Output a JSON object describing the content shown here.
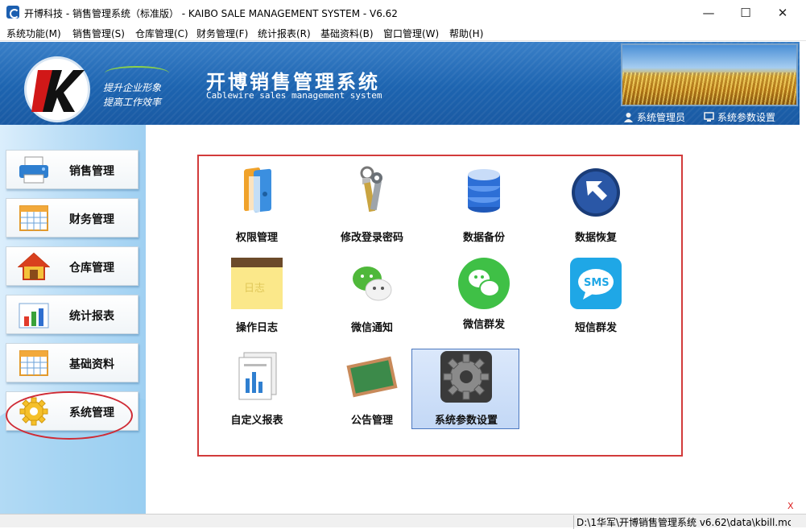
{
  "window": {
    "title": "开博科技 - 销售管理系统（标准版）      - KAIBO SALE MANAGEMENT SYSTEM - V6.62",
    "minimize": "—",
    "maximize": "☐",
    "close": "✕"
  },
  "menu": [
    "系统功能(M)",
    "销售管理(S)",
    "仓库管理(C)",
    "财务管理(F)",
    "统计报表(R)",
    "基础资料(B)",
    "窗口管理(W)",
    "帮助(H)"
  ],
  "header": {
    "slogan_line1": "提升企业形象",
    "slogan_line2": "提高工作效率",
    "system_title": "开博销售管理系统",
    "system_subtitle": "Cablewire sales management system",
    "links": {
      "admin": "系统管理员",
      "settings": "系统参数设置"
    }
  },
  "sidebar": {
    "items": [
      {
        "label": "销售管理",
        "icon": "printer-icon"
      },
      {
        "label": "财务管理",
        "icon": "calendar-icon"
      },
      {
        "label": "仓库管理",
        "icon": "house-icon"
      },
      {
        "label": "统计报表",
        "icon": "bar-chart-icon"
      },
      {
        "label": "基础资料",
        "icon": "table-icon"
      },
      {
        "label": "系统管理",
        "icon": "gear-icon"
      }
    ],
    "active": "系统管理"
  },
  "tiles": [
    {
      "label": "权限管理",
      "icon": "folders-icon"
    },
    {
      "label": "修改登录密码",
      "icon": "keys-icon"
    },
    {
      "label": "数据备份",
      "icon": "database-icon"
    },
    {
      "label": "数据恢复",
      "icon": "restore-arrow-icon"
    },
    {
      "label": "操作日志",
      "icon": "notepad-icon"
    },
    {
      "label": "微信通知",
      "icon": "wechat-icon"
    },
    {
      "label": "微信群发",
      "icon": "wechat-group-icon"
    },
    {
      "label": "短信群发",
      "icon": "sms-icon"
    },
    {
      "label": "自定义报表",
      "icon": "report-icon"
    },
    {
      "label": "公告管理",
      "icon": "board-icon"
    },
    {
      "label": "系统参数设置",
      "icon": "settings-gear-icon"
    }
  ],
  "selected_tile": "系统参数设置",
  "status": {
    "path": "D:\\1华军\\开博销售管理系统 v6.62\\data\\kbill.mc",
    "close": "X"
  },
  "colors": {
    "accent": "#1d64b0",
    "highlight": "#d23b3b",
    "selected": "#c3d8f6"
  }
}
